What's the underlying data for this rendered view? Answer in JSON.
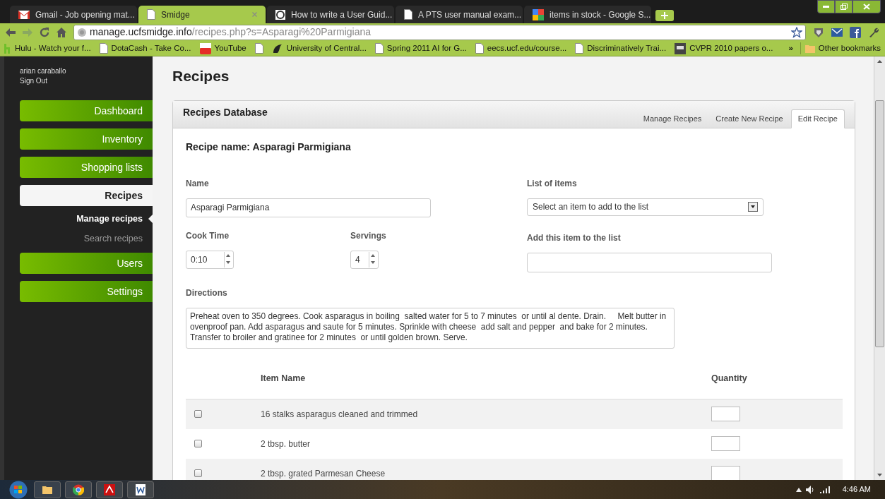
{
  "browser": {
    "tabs": [
      {
        "title": "Gmail - Job opening mat...",
        "kind": "mail",
        "selected": false
      },
      {
        "title": "Smidge",
        "kind": "page",
        "selected": true
      },
      {
        "title": "How to write a User Guid...",
        "kind": "wp",
        "selected": false
      },
      {
        "title": "A PTS user manual exam...",
        "kind": "page",
        "selected": false
      },
      {
        "title": "items in stock - Google S...",
        "kind": "google",
        "selected": false
      }
    ],
    "url_host": "manage.ucfsmidge.info",
    "url_path": "/recipes.php?s=Asparagi%20Parmigiana",
    "bookmarks": [
      {
        "title": "Hulu - Watch your f...",
        "kind": "hulu"
      },
      {
        "title": "DotaCash - Take Co...",
        "kind": "page"
      },
      {
        "title": "YouTube",
        "kind": "youtube"
      },
      {
        "kind": "page"
      },
      {
        "title": "University of Central...",
        "kind": "ucf"
      },
      {
        "title": "Spring 2011 AI for G...",
        "kind": "page"
      },
      {
        "title": "eecs.ucf.edu/course...",
        "kind": "page"
      },
      {
        "title": "Discriminatively Trai...",
        "kind": "page"
      },
      {
        "title": "CVPR 2010 papers o...",
        "kind": "cv"
      }
    ],
    "more": "»",
    "other_bookmarks": "Other bookmarks"
  },
  "user": {
    "name": "arian caraballo",
    "sign_out": "Sign Out"
  },
  "sidebar": {
    "items": [
      {
        "label": "Dashboard",
        "selected": false
      },
      {
        "label": "Inventory",
        "selected": false
      },
      {
        "label": "Shopping lists",
        "selected": false
      },
      {
        "label": "Recipes",
        "selected": true,
        "children": [
          {
            "label": "Manage recipes",
            "selected": true
          },
          {
            "label": "Search recipes",
            "selected": false
          }
        ]
      },
      {
        "label": "Users",
        "selected": false
      },
      {
        "label": "Settings",
        "selected": false
      }
    ]
  },
  "page_title": "Recipes",
  "panel": {
    "title": "Recipes Database",
    "tabs": [
      {
        "label": "Manage Recipes",
        "selected": false
      },
      {
        "label": "Create New Recipe",
        "selected": false
      },
      {
        "label": "Edit Recipe",
        "selected": true
      }
    ]
  },
  "form": {
    "heading": "Recipe name: Asparagi Parmigiana",
    "name_label": "Name",
    "name_value": "Asparagi Parmigiana",
    "list_label": "List of items",
    "list_value": "Select an item to add to the list",
    "cook_label": "Cook Time",
    "cook_value": "0:10",
    "servings_label": "Servings",
    "servings_value": "4",
    "add_label": "Add this item to the list",
    "directions_label": "Directions",
    "directions_value": "Preheat oven to 350 degrees. Cook asparagus in boiling  salted water for 5 to 7 minutes  or until al dente. Drain.     Melt butter in ovenproof pan. Add asparagus and saute for 5 minutes. Sprinkle with cheese  add salt and pepper  and bake for 2 minutes.  Transfer to broiler and gratinee for 2 minutes  or until golden brown. Serve."
  },
  "table": {
    "columns": [
      "Item Name",
      "Quantity"
    ],
    "rows": [
      {
        "item": "16 stalks asparagus cleaned and trimmed",
        "checked": false
      },
      {
        "item": "2 tbsp. butter",
        "checked": false
      },
      {
        "item": "2 tbsp. grated Parmesan Cheese",
        "checked": false
      }
    ]
  },
  "taskbar": {
    "time": "4:46 AM"
  }
}
